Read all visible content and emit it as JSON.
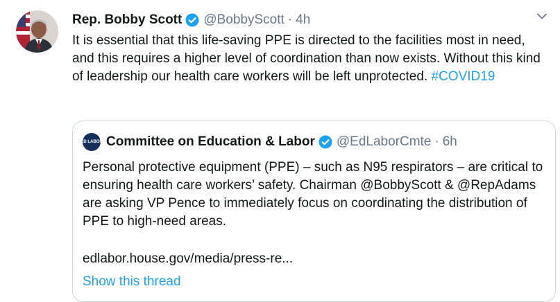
{
  "tweet": {
    "author_name": "Rep. Bobby Scott",
    "handle": "@BobbyScott",
    "separator": "·",
    "time": "4h",
    "text_before_hashtag": "It is essential that this life-saving PPE is directed to the facilities most in need, and this requires a higher level of coordination than now exists. Without this kind of leadership our health care workers will be left unprotected.",
    "hashtag": "#COVID19"
  },
  "quoted": {
    "logo_text": "ED LABOR",
    "author_name": "Committee on Education & Labor",
    "handle": "@EdLaborCmte",
    "separator": "·",
    "time": "6h",
    "text": "Personal protective equipment (PPE) – such as N95 respirators – are critical to ensuring health care workers’ safety. Chairman @BobbyScott & @RepAdams are asking VP Pence to immediately focus on coordinating the distribution of PPE to high-need areas.",
    "link": "edlabor.house.gov/media/press-re...",
    "show_thread": "Show this thread"
  },
  "icons": {
    "verified": "verified-badge-icon",
    "caret": "chevron-down-icon"
  },
  "colors": {
    "accent": "#1da1f2",
    "secondary_text": "#657786",
    "border": "#ccd6dd",
    "logo_bg": "#14305a"
  }
}
